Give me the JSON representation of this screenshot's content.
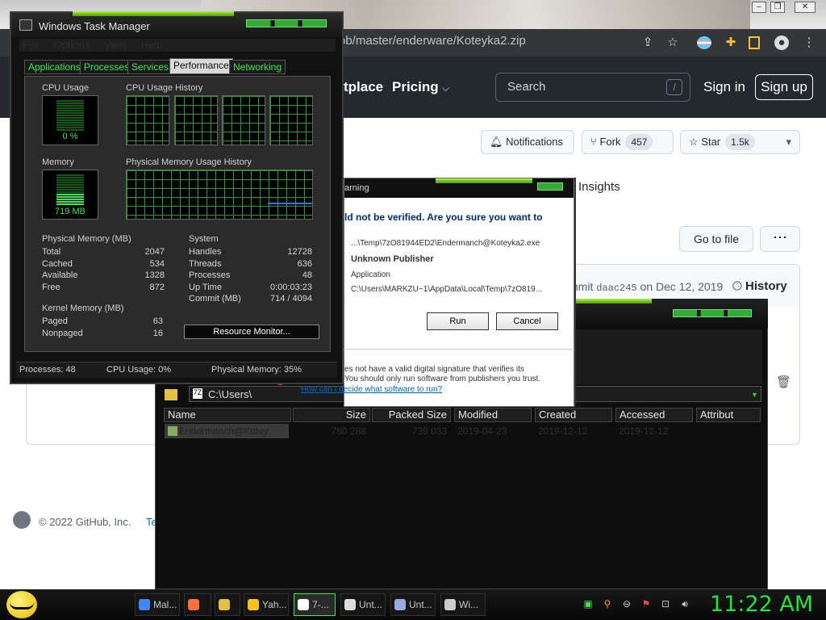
{
  "browser": {
    "url": "ob/master/enderware/Koteyka2.zip",
    "icons": [
      "share-icon",
      "star-icon",
      "flag-icon",
      "extensions-icon",
      "sidebar-icon",
      "profile-icon",
      "menu-icon"
    ]
  },
  "github": {
    "nav": [
      "tplace",
      "Pricing"
    ],
    "search_placeholder": "Search",
    "search_key": "/",
    "sign_in": "Sign in",
    "sign_up": "Sign up",
    "notifications": "Notifications",
    "fork": "Fork",
    "fork_count": "457",
    "star": "Star",
    "star_count": "1.5k",
    "insights": "Insights",
    "go_to_file": "Go to file",
    "more": "⋯",
    "commit_prefix": "mmit",
    "commit_hash": "daac245",
    "commit_date": "on Dec 12, 2019",
    "history": "History",
    "footer": "© 2022 GitHub, Inc.",
    "footer_link": "Te"
  },
  "taskmgr": {
    "title": "Windows Task Manager",
    "menu": [
      "File",
      "Options",
      "View",
      "Help"
    ],
    "tabs": [
      "Applications",
      "Processes",
      "Services",
      "Performance",
      "Networking"
    ],
    "cpu_usage_label": "CPU Usage",
    "cpu_usage_value": "0 %",
    "cpu_history_label": "CPU Usage History",
    "memory_label": "Memory",
    "memory_value": "719 MB",
    "phys_history_label": "Physical Memory Usage History",
    "physical_memory": {
      "label": "Physical Memory (MB)",
      "rows": [
        [
          "Total",
          "2047"
        ],
        [
          "Cached",
          "534"
        ],
        [
          "Available",
          "1328"
        ],
        [
          "Free",
          "872"
        ]
      ]
    },
    "system": {
      "label": "System",
      "rows": [
        [
          "Handles",
          "12728"
        ],
        [
          "Threads",
          "636"
        ],
        [
          "Processes",
          "48"
        ],
        [
          "Up Time",
          "0:00:03:23"
        ],
        [
          "Commit (MB)",
          "714 / 4094"
        ]
      ]
    },
    "kernel_memory": {
      "label": "Kernel Memory (MB)",
      "rows": [
        [
          "Paged",
          "63"
        ],
        [
          "Nonpaged",
          "16"
        ]
      ]
    },
    "resource_monitor": "Resource Monitor...",
    "status": {
      "processes": "Processes: 48",
      "cpu": "CPU Usage: 0%",
      "memory": "Physical Memory: 35%"
    }
  },
  "warning": {
    "title": "Warning",
    "question": "ld not be verified.  Are you sure you want to",
    "name": "...\\Temp\\7zO81944ED2\\Endermanch@Koteyka2.exe",
    "publisher": "Unknown Publisher",
    "type": "Application",
    "from": "C:\\Users\\MARKZU~1\\AppData\\Local\\Temp\\7zO819...",
    "run": "Run",
    "cancel": "Cancel",
    "footer1": "es not have a valid digital signature that verifies its",
    "footer2": "You should only run software from publishers you trust.",
    "link": "How can I decide what software to run?"
  },
  "zip": {
    "path": "C:\\Users\\",
    "columns": [
      "Name",
      "Size",
      "Packed Size",
      "Modified",
      "Created",
      "Accessed",
      "Attribut"
    ],
    "row": [
      "Endermanch@Kotey",
      "780 288",
      "739 033",
      "2019-04-23",
      "2019-12-12",
      "2019-12-12",
      ""
    ]
  },
  "taskbar": {
    "items": [
      "Mal...",
      "",
      "",
      "Yah...",
      "7-...",
      "Unt...",
      "Unt...",
      "Wi..."
    ],
    "clock": "11:22 AM"
  }
}
